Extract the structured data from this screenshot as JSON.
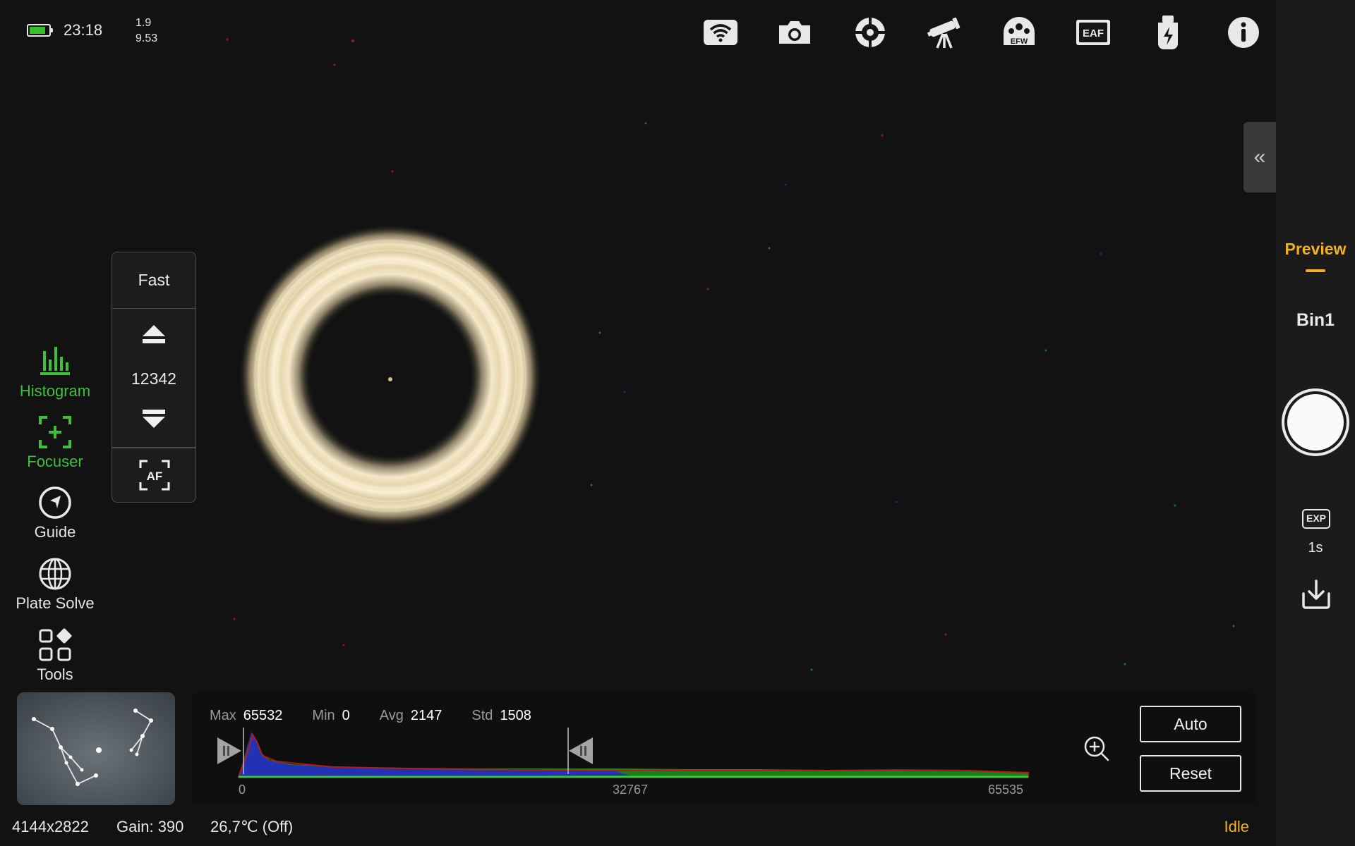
{
  "status": {
    "battery_level": 0.85,
    "time": "23:18",
    "voltage_line1": "1.9",
    "voltage_line2": "9.53"
  },
  "toolbar": {
    "items": [
      {
        "icon": "wifi-icon"
      },
      {
        "icon": "camera-icon"
      },
      {
        "icon": "guide-target-icon"
      },
      {
        "icon": "telescope-icon"
      },
      {
        "icon": "efw-icon",
        "label": "EFW"
      },
      {
        "icon": "eaf-icon",
        "label": "EAF"
      },
      {
        "icon": "power-usb-icon"
      },
      {
        "icon": "info-icon"
      }
    ]
  },
  "right_panel": {
    "mode": "Preview",
    "bin": "Bin1",
    "exp_badge": "EXP",
    "exposure": "1s"
  },
  "tools": [
    {
      "label": "Histogram",
      "icon": "histogram-icon",
      "active": true
    },
    {
      "label": "Focuser",
      "icon": "focuser-icon",
      "active": true
    },
    {
      "label": "Guide",
      "icon": "compass-icon",
      "active": false
    },
    {
      "label": "Plate Solve",
      "icon": "globe-icon",
      "active": false
    },
    {
      "label": "Tools",
      "icon": "grid-icon",
      "active": false
    }
  ],
  "focuser": {
    "speed": "Fast",
    "position": "12342",
    "af_label": "AF"
  },
  "histogram": {
    "stats": [
      {
        "key": "Max",
        "value": "65532"
      },
      {
        "key": "Min",
        "value": "0"
      },
      {
        "key": "Avg",
        "value": "2147"
      },
      {
        "key": "Std",
        "value": "1508"
      }
    ],
    "axis": [
      "0",
      "32767",
      "65535"
    ],
    "auto_label": "Auto",
    "reset_label": "Reset"
  },
  "bottom": {
    "resolution": "4144x2822",
    "gain": "Gain: 390",
    "temperature": "26,7℃  (Off)",
    "state": "Idle"
  },
  "colors": {
    "accent": "#f2b21f",
    "active_tool": "#3fbf3a"
  }
}
